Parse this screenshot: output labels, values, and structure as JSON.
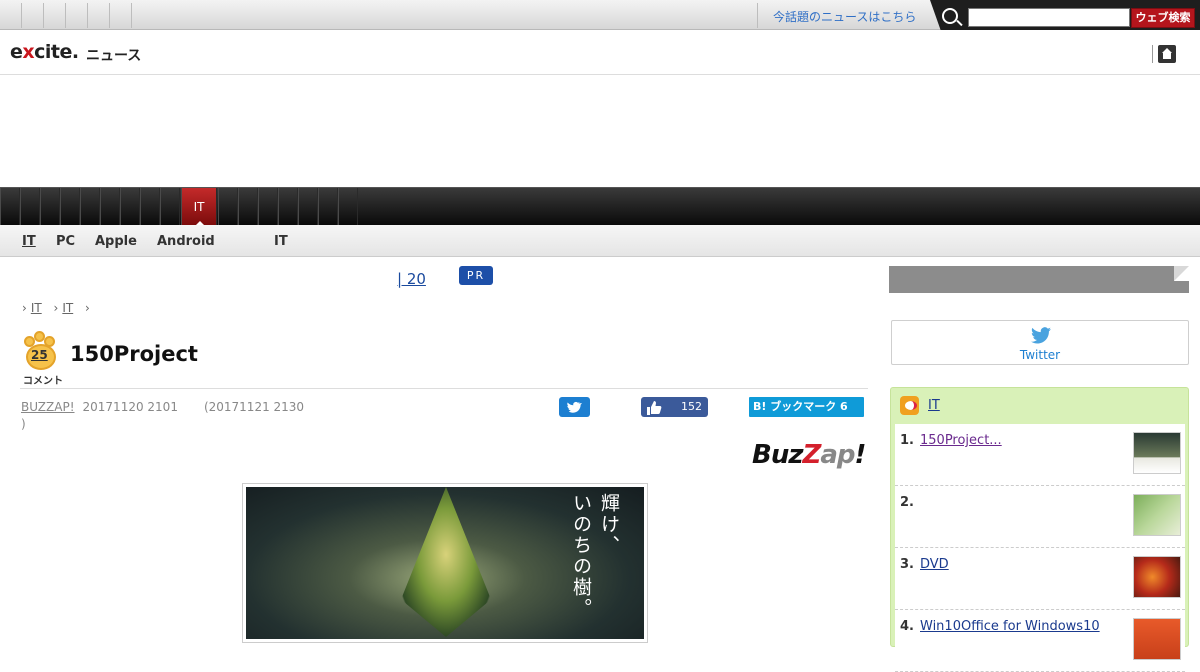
{
  "topbar": {
    "news_link": "今話題のニュースはこちら",
    "search_placeholder": "",
    "search_button": "ウェブ検索"
  },
  "logo": {
    "brand_e": "e",
    "brand_x": "x",
    "brand_rest": "cite.",
    "sub": "ニュース"
  },
  "nav": {
    "active_tab": "IT"
  },
  "subnav": {
    "items": [
      "IT",
      "PC",
      "Apple",
      "Android",
      "IT"
    ]
  },
  "main": {
    "pr_link": "| 20",
    "pr_badge": "PR",
    "breadcrumb": [
      "IT",
      "IT"
    ],
    "comment_count": "25",
    "comment_label": "コメント",
    "title": "150Project",
    "source": "BUZZAP!",
    "published": "20171120 2101",
    "updated": "(20171121 2130",
    "updated_close": ")",
    "fb_count": "152",
    "hatena_label": "B! ブックマーク 6",
    "publisher_logo": {
      "p1": "Buz",
      "p2": "Z",
      "p3": "ap",
      "p4": "!"
    },
    "hero_text": [
      "輝け、",
      "いのちの樹。"
    ]
  },
  "sidebar": {
    "twitter_label": "Twitter",
    "ranking_title": "IT",
    "ranking": [
      {
        "num": "1.",
        "title": "150Project..."
      },
      {
        "num": "2.",
        "title": ""
      },
      {
        "num": "3.",
        "title": "DVD"
      },
      {
        "num": "4.",
        "title": "Win10Office for Windows10"
      }
    ]
  },
  "colors": {
    "accent_red": "#b4151c",
    "link_blue": "#1a3a8e",
    "ranking_bg": "#d9f1b8"
  }
}
